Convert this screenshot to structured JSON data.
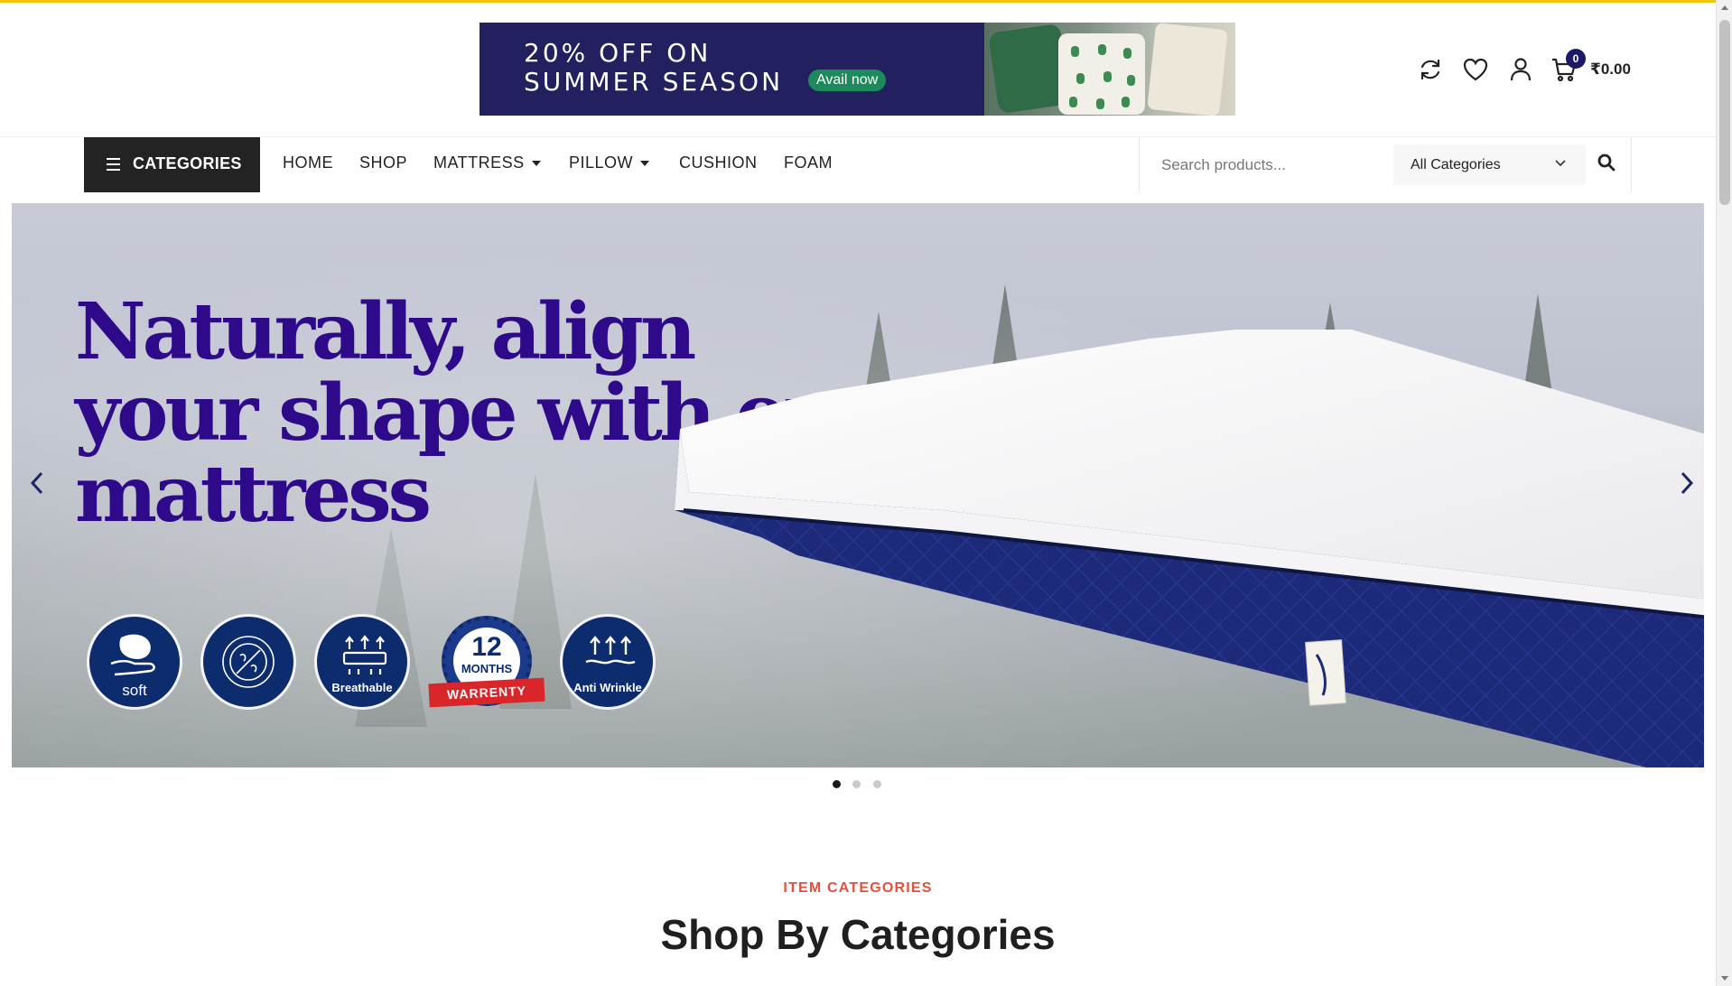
{
  "promo": {
    "line1": "20% OFF ON",
    "line2": "SUMMER SEASON",
    "cta": "Avail now"
  },
  "header_icons": {
    "compare": "refresh-icon",
    "wishlist": "heart-icon",
    "account": "user-icon",
    "cart": "cart-icon",
    "cart_count": "0",
    "cart_total": "₹0.00"
  },
  "nav": {
    "categories_label": "CATEGORIES",
    "items": [
      {
        "label": "HOME"
      },
      {
        "label": "SHOP"
      },
      {
        "label": "MATTRESS"
      },
      {
        "label": "PILLOW"
      },
      {
        "label": "CUSHION"
      },
      {
        "label": "FOAM"
      }
    ]
  },
  "search": {
    "placeholder": "Search products...",
    "category_selected": "All Categories"
  },
  "hero": {
    "title_line1": "Naturally, align",
    "title_line2": "your shape with our",
    "title_line3": "mattress",
    "badges": {
      "soft": "soft",
      "breathable": "Breathable",
      "warranty_number": "12",
      "warranty_unit": "MONTHS",
      "warranty_label": "WARRENTY",
      "anti_wrinkle": "Anti Wrinkle"
    },
    "active_slide": 1,
    "slide_count": 3
  },
  "section": {
    "tag": "ITEM CATEGORIES",
    "title": "Shop By Categories"
  },
  "colors": {
    "accent_strip": "#f1c40f",
    "hero_title": "#2e0a8a",
    "section_tag": "#e0523f",
    "promo_bg": "#23205f",
    "badge_blue": "#0d2c6e"
  }
}
